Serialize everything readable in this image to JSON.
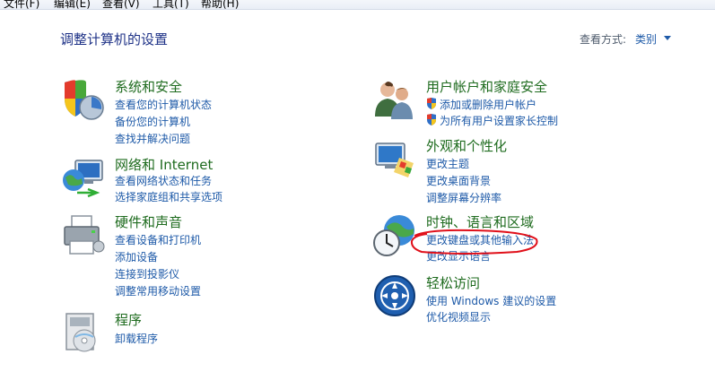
{
  "menubar": {
    "items": [
      "文件(F)",
      "编辑(E)",
      "查看(V)",
      "工具(T)",
      "帮助(H)"
    ]
  },
  "page_title": "调整计算机的设置",
  "view_by": {
    "label": "查看方式:",
    "value": "类别"
  },
  "categories": [
    {
      "title": "系统和安全",
      "icon": "shield-chart-icon",
      "links": [
        "查看您的计算机状态",
        "备份您的计算机",
        "查找并解决问题"
      ]
    },
    {
      "title": "网络和 Internet",
      "icon": "network-globe-icon",
      "links": [
        "查看网络状态和任务",
        "选择家庭组和共享选项"
      ]
    },
    {
      "title": "硬件和声音",
      "icon": "printer-icon",
      "links": [
        "查看设备和打印机",
        "添加设备",
        "连接到投影仪",
        "调整常用移动设置"
      ]
    },
    {
      "title": "程序",
      "icon": "programs-box-icon",
      "links": [
        "卸载程序"
      ]
    },
    {
      "title": "用户帐户和家庭安全",
      "icon": "users-icon",
      "links": [
        "添加或删除用户帐户",
        "为所有用户设置家长控制"
      ]
    },
    {
      "title": "外观和个性化",
      "icon": "monitor-palette-icon",
      "links": [
        "更改主题",
        "更改桌面背景",
        "调整屏幕分辨率"
      ]
    },
    {
      "title": "时钟、语言和区域",
      "icon": "clock-globe-icon",
      "links": [
        "更改键盘或其他输入法",
        "更改显示语言"
      ]
    },
    {
      "title": "轻松访问",
      "icon": "ease-of-access-icon",
      "links": [
        "使用 Windows 建议的设置",
        "优化视频显示"
      ]
    }
  ],
  "colors": {
    "title_blue": "#1e3287",
    "category_green": "#1e6b1e",
    "link_blue": "#1e5aa8",
    "annotation_red": "#e0101a"
  }
}
